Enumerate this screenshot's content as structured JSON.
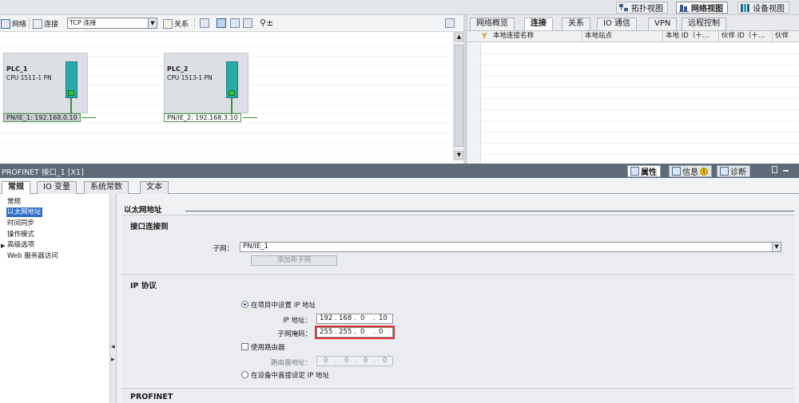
{
  "views": {
    "topology": "拓扑视图",
    "network": "网络视图",
    "device": "设备视图"
  },
  "net_toolbar": {
    "network": "网络",
    "connect": "连接",
    "connection_type": "TCP 连接",
    "relations": "关系"
  },
  "devices": [
    {
      "name": "PLC_1",
      "type": "CPU 1511-1 PN",
      "interface": "PN/IE_1: 192.168.0.10"
    },
    {
      "name": "PLC_2",
      "type": "CPU 1513-1 PN",
      "interface": "PN/IE_2: 192.168.3.10"
    }
  ],
  "right_tabs": [
    "网络概览",
    "连接",
    "关系",
    "IO 通信",
    "VPN",
    "远程控制"
  ],
  "conn_table": {
    "columns": [
      "本地连接名称",
      "本地站点",
      "本地 ID（十…",
      "伙伴 ID（十…",
      "伙伴"
    ]
  },
  "inspector": {
    "title": "PROFINET 接口_1 [X1]",
    "tabs": [
      "属性",
      "信息",
      "诊断"
    ],
    "prop_tabs": [
      "常规",
      "IO 变量",
      "系统常数",
      "文本"
    ]
  },
  "nav_items": [
    "常规",
    "以太网地址",
    "时间同步",
    "操作模式",
    "高级选项",
    "Web 服务器访问"
  ],
  "ethernet": {
    "title": "以太网地址",
    "iface_section": "接口连接到",
    "subnet_label": "子网：",
    "subnet_value": "PN/IE_1",
    "add_subnet": "添加新子网",
    "ip_section": "IP 协议",
    "opt_project": "在项目中设置 IP 地址",
    "ip_label": "IP 地址：",
    "ip": [
      "192",
      "168",
      "0",
      "10"
    ],
    "mask_label": "子网掩码：",
    "mask": [
      "255",
      "255",
      "0",
      "0"
    ],
    "use_router": "使用路由器",
    "router_label": "路由器地址：",
    "router": [
      "0",
      "0",
      "0",
      "0"
    ],
    "opt_device": "在设备中直接设定 IP 地址",
    "profinet_section": "PROFINET"
  }
}
